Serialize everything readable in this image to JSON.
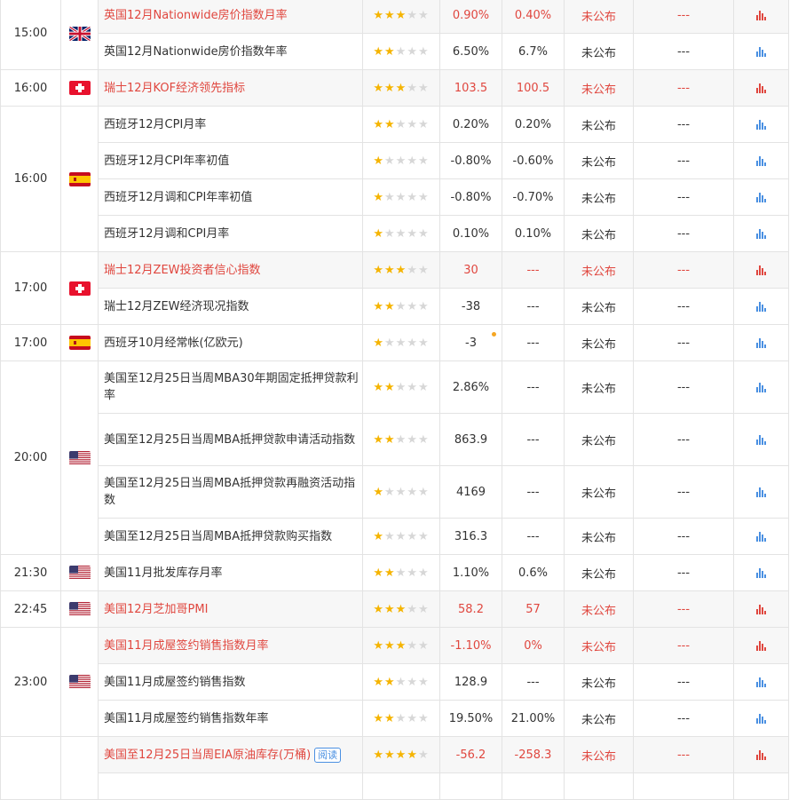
{
  "colors": {
    "highlight_text": "#e0473f",
    "star_filled": "#f5b400",
    "star_empty": "#d7d7d7",
    "chart_red": "#e0473f",
    "chart_blue": "#4a90e2"
  },
  "groups": [
    {
      "time": "15:00",
      "country": "uk",
      "rows": [
        {
          "name": "英国12月Nationwide房价指数月率",
          "stars": 3,
          "actual": "0.90%",
          "forecast": "0.40%",
          "previous": "未公布",
          "col6": "---",
          "highlight": true
        },
        {
          "name": "英国12月Nationwide房价指数年率",
          "stars": 2,
          "actual": "6.50%",
          "forecast": "6.7%",
          "previous": "未公布",
          "col6": "---",
          "highlight": false
        }
      ]
    },
    {
      "time": "16:00",
      "country": "switzerland",
      "rows": [
        {
          "name": "瑞士12月KOF经济领先指标",
          "stars": 3,
          "actual": "103.5",
          "forecast": "100.5",
          "previous": "未公布",
          "col6": "---",
          "highlight": true
        }
      ]
    },
    {
      "time": "16:00",
      "country": "spain",
      "rows": [
        {
          "name": "西班牙12月CPI月率",
          "stars": 2,
          "actual": "0.20%",
          "forecast": "0.20%",
          "previous": "未公布",
          "col6": "---",
          "highlight": false
        },
        {
          "name": "西班牙12月CPI年率初值",
          "stars": 1,
          "actual": "-0.80%",
          "forecast": "-0.60%",
          "previous": "未公布",
          "col6": "---",
          "highlight": false
        },
        {
          "name": "西班牙12月调和CPI年率初值",
          "stars": 1,
          "actual": "-0.80%",
          "forecast": "-0.70%",
          "previous": "未公布",
          "col6": "---",
          "highlight": false
        },
        {
          "name": "西班牙12月调和CPI月率",
          "stars": 1,
          "actual": "0.10%",
          "forecast": "0.10%",
          "previous": "未公布",
          "col6": "---",
          "highlight": false
        }
      ]
    },
    {
      "time": "17:00",
      "country": "switzerland",
      "rows": [
        {
          "name": "瑞士12月ZEW投资者信心指数",
          "stars": 3,
          "actual": "30",
          "forecast": "---",
          "previous": "未公布",
          "col6": "---",
          "highlight": true
        },
        {
          "name": "瑞士12月ZEW经济现况指数",
          "stars": 2,
          "actual": "-38",
          "forecast": "---",
          "previous": "未公布",
          "col6": "---",
          "highlight": false
        }
      ]
    },
    {
      "time": "17:00",
      "country": "spain",
      "rows": [
        {
          "name": "西班牙10月经常帐(亿欧元)",
          "stars": 1,
          "actual": "-3",
          "forecast": "---",
          "previous": "未公布",
          "col6": "---",
          "highlight": false,
          "dot": true
        }
      ]
    },
    {
      "time": "20:00",
      "country": "usa",
      "rows": [
        {
          "name": "美国至12月25日当周MBA30年期固定抵押贷款利率",
          "stars": 2,
          "actual": "2.86%",
          "forecast": "---",
          "previous": "未公布",
          "col6": "---",
          "highlight": false
        },
        {
          "name": "美国至12月25日当周MBA抵押贷款申请活动指数",
          "stars": 2,
          "actual": "863.9",
          "forecast": "---",
          "previous": "未公布",
          "col6": "---",
          "highlight": false
        },
        {
          "name": "美国至12月25日当周MBA抵押贷款再融资活动指数",
          "stars": 1,
          "actual": "4169",
          "forecast": "---",
          "previous": "未公布",
          "col6": "---",
          "highlight": false
        },
        {
          "name": "美国至12月25日当周MBA抵押贷款购买指数",
          "stars": 1,
          "actual": "316.3",
          "forecast": "---",
          "previous": "未公布",
          "col6": "---",
          "highlight": false
        }
      ]
    },
    {
      "time": "21:30",
      "country": "usa",
      "rows": [
        {
          "name": "美国11月批发库存月率",
          "stars": 2,
          "actual": "1.10%",
          "forecast": "0.6%",
          "previous": "未公布",
          "col6": "---",
          "highlight": false
        }
      ]
    },
    {
      "time": "22:45",
      "country": "usa",
      "rows": [
        {
          "name": "美国12月芝加哥PMI",
          "stars": 3,
          "actual": "58.2",
          "forecast": "57",
          "previous": "未公布",
          "col6": "---",
          "highlight": true
        }
      ]
    },
    {
      "time": "23:00",
      "country": "usa",
      "rows": [
        {
          "name": "美国11月成屋签约销售指数月率",
          "stars": 3,
          "actual": "-1.10%",
          "forecast": "0%",
          "previous": "未公布",
          "col6": "---",
          "highlight": true
        },
        {
          "name": "美国11月成屋签约销售指数",
          "stars": 2,
          "actual": "128.9",
          "forecast": "---",
          "previous": "未公布",
          "col6": "---",
          "highlight": false
        },
        {
          "name": "美国11月成屋签约销售指数年率",
          "stars": 2,
          "actual": "19.50%",
          "forecast": "21.00%",
          "previous": "未公布",
          "col6": "---",
          "highlight": false
        }
      ]
    },
    {
      "time": "",
      "country": "",
      "rows": [
        {
          "name": "美国至12月25日当周EIA原油库存(万桶)",
          "stars": 4,
          "actual": "-56.2",
          "forecast": "-258.3",
          "previous": "未公布",
          "col6": "---",
          "highlight": true,
          "tag": "阅读"
        },
        {
          "name": "",
          "stars": 0,
          "actual": "",
          "forecast": "",
          "previous": "",
          "col6": "",
          "highlight": false,
          "blank": true
        }
      ]
    }
  ]
}
